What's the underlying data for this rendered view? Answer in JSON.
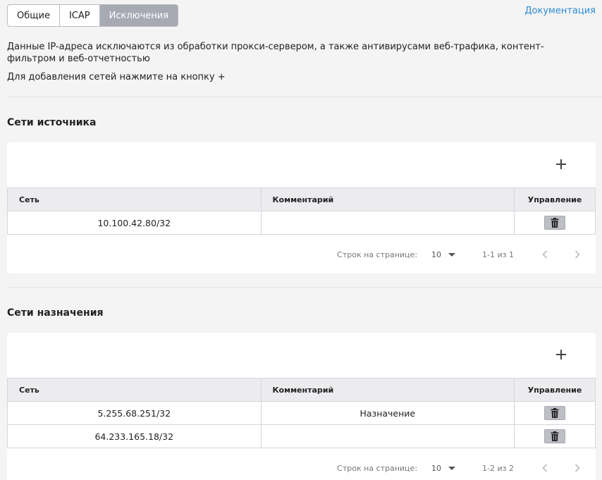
{
  "tabs": [
    "Общие",
    "ICAP",
    "Исключения"
  ],
  "doc_link": "Документация",
  "description": "Данные IP-адреса исключаются из обработки прокси-сервером, а также антивирусами веб-трафика, контент-фильтром и веб-отчетностью",
  "hint": "Для добавления сетей нажмите на кнопку +",
  "columns": {
    "network": "Сеть",
    "comment": "Комментарий",
    "control": "Управление"
  },
  "source": {
    "title": "Сети источника",
    "rows": [
      {
        "network": "10.100.42.80/32",
        "comment": ""
      }
    ],
    "pager": {
      "rows_label": "Строк на странице:",
      "rows_value": "10",
      "range": "1-1 из 1"
    }
  },
  "destination": {
    "title": "Сети назначения",
    "rows": [
      {
        "network": "5.255.68.251/32",
        "comment": "Назначение"
      },
      {
        "network": "64.233.165.18/32",
        "comment": ""
      }
    ],
    "pager": {
      "rows_label": "Строк на странице:",
      "rows_value": "10",
      "range": "1-2 из 2"
    }
  },
  "icons": {
    "add": "plus-icon",
    "delete": "trash-icon",
    "prev": "chevron-left-icon",
    "next": "chevron-right-icon",
    "dropdown": "caret-down-icon"
  },
  "colors": {
    "active_tab": "#a7aab3",
    "link": "#2b8bd3",
    "header_bg": "#ececef"
  }
}
